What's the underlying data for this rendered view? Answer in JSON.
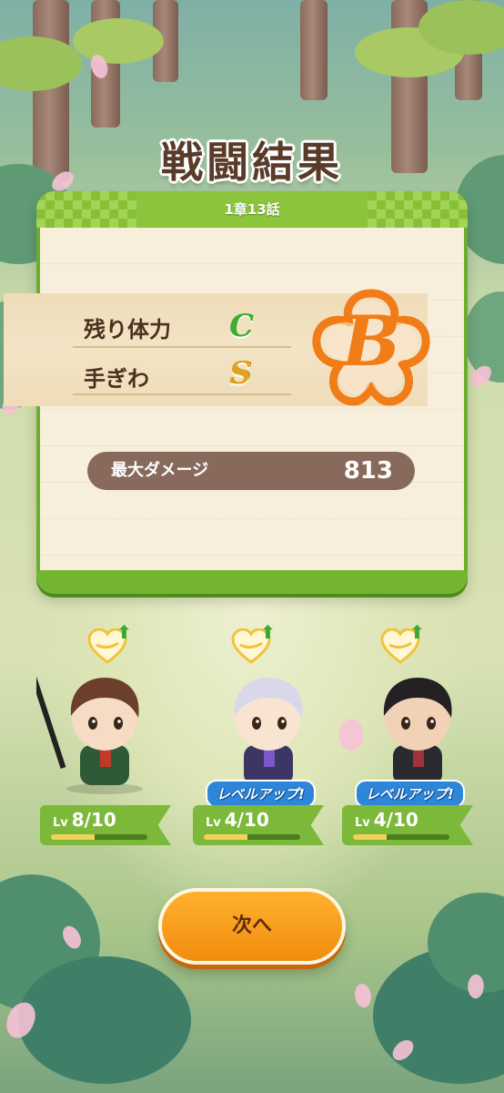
{
  "result": {
    "title": "戦闘結果",
    "chapter": "1章13話",
    "rows": [
      {
        "label": "残り体力",
        "grade": "C"
      },
      {
        "label": "手ぎわ",
        "grade": "S"
      }
    ],
    "overall_grade": "B",
    "max_damage_label": "最大ダメージ",
    "max_damage_value": "813"
  },
  "characters": [
    {
      "level_prefix": "Lv",
      "level": "8/10",
      "exp_fraction": 0.45,
      "level_up": false,
      "level_up_text": ""
    },
    {
      "level_prefix": "Lv",
      "level": "4/10",
      "exp_fraction": 0.45,
      "level_up": true,
      "level_up_text": "レベルアップ!"
    },
    {
      "level_prefix": "Lv",
      "level": "4/10",
      "exp_fraction": 0.35,
      "level_up": true,
      "level_up_text": "レベルアップ!"
    }
  ],
  "next_button": "次へ",
  "colors": {
    "grade_c": "#3fae2c",
    "grade_s": "#e2a21c",
    "grade_b": "#f07d17",
    "level_up": "#2e86d8",
    "button": "#f59b1c"
  },
  "icons": [
    "heart-icon",
    "up-arrow-icon",
    "grade-stamp-icon"
  ]
}
